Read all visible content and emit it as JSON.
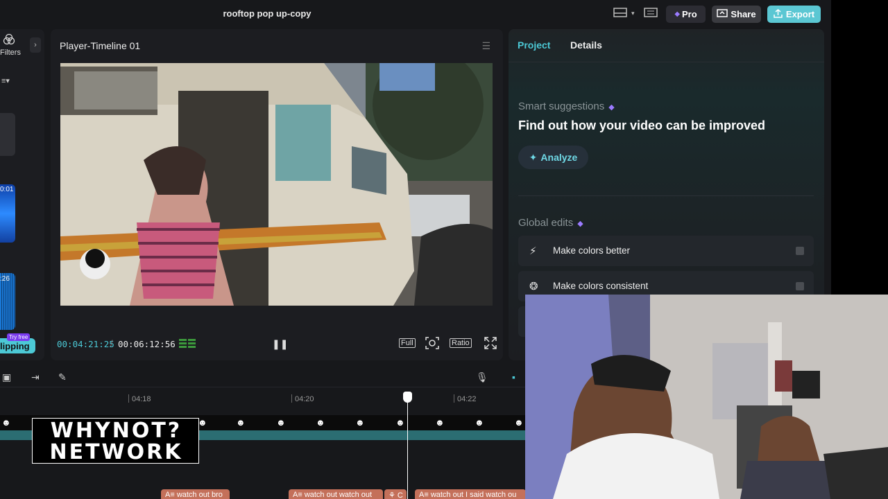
{
  "top_bar": {
    "title": "rooftop pop up-copy",
    "pro_label": "Pro",
    "share_label": "Share",
    "export_label": "Export"
  },
  "left_panel": {
    "filters_label": "Filters",
    "thumb_time_1": "0:01",
    "thumb_time_2": ":26",
    "clipping_label": "lipping",
    "try_free_label": "Try free"
  },
  "player": {
    "title": "Player-Timeline 01",
    "current_time": "00:04:21:25",
    "separator": "/",
    "total_time": "00:06:12:56",
    "full_label": "Full",
    "ratio_label": "Ratio"
  },
  "right_panel": {
    "tabs": [
      {
        "label": "Project",
        "active": true
      },
      {
        "label": "Details",
        "active": false
      }
    ],
    "smart_suggestions_label": "Smart suggestions",
    "smart_suggestions_title": "Find out how your video can be improved",
    "analyze_label": "Analyze",
    "global_edits_label": "Global edits",
    "global_edits": [
      {
        "label": "Make colors better",
        "icon": "magic-wand-icon"
      },
      {
        "label": "Make colors consistent",
        "icon": "color-match-icon"
      }
    ]
  },
  "timeline": {
    "ruler": [
      "04:18",
      "04:20",
      "04:22"
    ],
    "captions": [
      "watch out bro",
      "watch out watch out",
      "C",
      "watch out I said watch ou"
    ]
  },
  "overlay": {
    "logo_line_1": "WHYNOT?",
    "logo_line_2": "NETWORK"
  },
  "colors": {
    "accent": "#4cc9d6",
    "background": "#17181b",
    "caption_clip": "#c4705a",
    "pro_gem": "#9b7bff"
  }
}
